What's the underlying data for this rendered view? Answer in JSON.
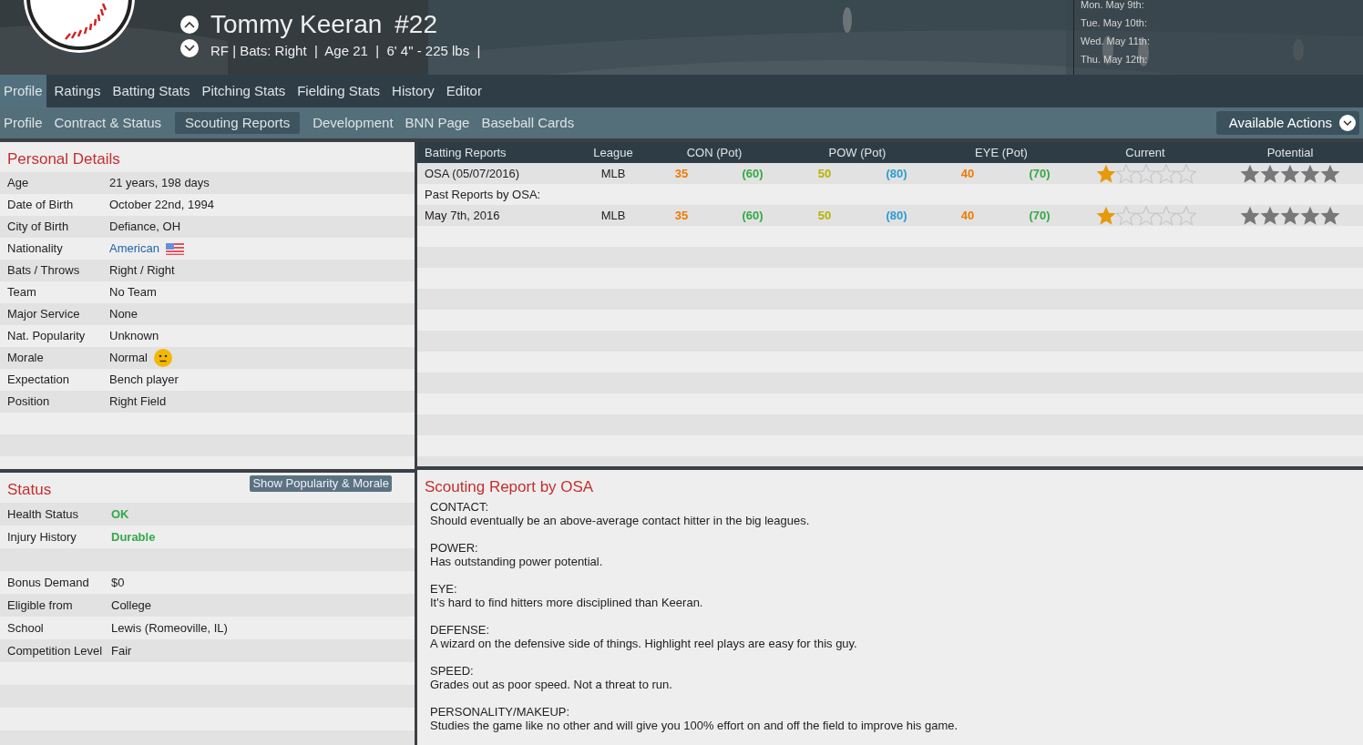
{
  "player": {
    "name": "Tommy Keeran",
    "number": "#22",
    "summary": "RF | Bats: Right  |  Age 21  |  6' 4\" - 225 lbs  |"
  },
  "schedule": [
    "Mon. May 9th:",
    "Tue. May 10th:",
    "Wed. May 11th:",
    "Thu. May 12th:"
  ],
  "main_tabs": [
    {
      "label": "Profile",
      "selected": true
    },
    {
      "label": "Ratings",
      "selected": false
    },
    {
      "label": "Batting Stats",
      "selected": false
    },
    {
      "label": "Pitching Stats",
      "selected": false
    },
    {
      "label": "Fielding Stats",
      "selected": false
    },
    {
      "label": "History",
      "selected": false
    },
    {
      "label": "Editor",
      "selected": false
    }
  ],
  "sub_tabs": [
    {
      "label": "Profile",
      "selected": false
    },
    {
      "label": "Contract & Status",
      "selected": false
    },
    {
      "label": "Scouting Reports",
      "selected": true
    },
    {
      "label": "Development",
      "selected": false
    },
    {
      "label": "BNN Page",
      "selected": false
    },
    {
      "label": "Baseball Cards",
      "selected": false
    }
  ],
  "actions_button": "Available Actions",
  "personal_details": {
    "title": "Personal Details",
    "rows": [
      {
        "label": "Age",
        "value": "21 years, 198 days",
        "kind": "text"
      },
      {
        "label": "Date of Birth",
        "value": "October 22nd, 1994",
        "kind": "text"
      },
      {
        "label": "City of Birth",
        "value": "Defiance, OH",
        "kind": "text"
      },
      {
        "label": "Nationality",
        "value": "American",
        "kind": "link"
      },
      {
        "label": "Bats / Throws",
        "value": "Right / Right",
        "kind": "text"
      },
      {
        "label": "Team",
        "value": "No Team",
        "kind": "text"
      },
      {
        "label": "Major Service",
        "value": "None",
        "kind": "text"
      },
      {
        "label": "Nat. Popularity",
        "value": "Unknown",
        "kind": "text"
      },
      {
        "label": "Morale",
        "value": "Normal",
        "kind": "morale"
      },
      {
        "label": "Expectation",
        "value": "Bench player",
        "kind": "text"
      },
      {
        "label": "Position",
        "value": "Right Field",
        "kind": "text"
      }
    ]
  },
  "status": {
    "title": "Status",
    "button": "Show Popularity & Morale",
    "health": [
      {
        "label": "Health Status",
        "value": "OK",
        "kind": "good"
      },
      {
        "label": "Injury History",
        "value": "Durable",
        "kind": "good"
      }
    ],
    "draft": [
      {
        "label": "Bonus Demand",
        "value": "$0",
        "kind": "text"
      },
      {
        "label": "Eligible from",
        "value": "College",
        "kind": "text"
      },
      {
        "label": "School",
        "value": "Lewis (Romeoville, IL)",
        "kind": "text"
      },
      {
        "label": "Competition Level",
        "value": "Fair",
        "kind": "text"
      }
    ]
  },
  "reports_table": {
    "columns": [
      "Batting Reports",
      "League",
      "CON (Pot)",
      "POW (Pot)",
      "EYE (Pot)",
      "Current",
      "Potential"
    ],
    "rows": [
      {
        "kind": "report",
        "scout": "OSA (05/07/2016)",
        "league": "MLB",
        "ratings": [
          {
            "value": "35",
            "color": "#f07800"
          },
          {
            "value": "(60)",
            "color": "#36a845"
          },
          {
            "value": "50",
            "color": "#b5b300"
          },
          {
            "value": "(80)",
            "color": "#2c9ccf"
          },
          {
            "value": "40",
            "color": "#f07800"
          },
          {
            "value": "(70)",
            "color": "#36a845"
          }
        ],
        "current": {
          "stars": 1
        },
        "potential": {
          "stars": 5
        }
      },
      {
        "kind": "section",
        "label": "Past Reports by OSA:"
      },
      {
        "kind": "report",
        "scout": "May 7th, 2016",
        "league": "MLB",
        "ratings": [
          {
            "value": "35",
            "color": "#f07800"
          },
          {
            "value": "(60)",
            "color": "#36a845"
          },
          {
            "value": "50",
            "color": "#b5b300"
          },
          {
            "value": "(80)",
            "color": "#2c9ccf"
          },
          {
            "value": "40",
            "color": "#f07800"
          },
          {
            "value": "(70)",
            "color": "#36a845"
          }
        ],
        "current": {
          "stars": 1
        },
        "potential": {
          "stars": 5
        }
      }
    ]
  },
  "scouting_report": {
    "title": "Scouting Report by OSA",
    "sections": [
      {
        "heading": "CONTACT:",
        "text": "Should eventually be an above-average contact hitter in the big leagues."
      },
      {
        "heading": "POWER:",
        "text": "Has outstanding power potential."
      },
      {
        "heading": "EYE:",
        "text": "It's hard to find hitters more disciplined than Keeran."
      },
      {
        "heading": "DEFENSE:",
        "text": "A wizard on the defensive side of things. Highlight reel plays are easy for this guy."
      },
      {
        "heading": "SPEED:",
        "text": "Grades out as poor speed. Not a threat to run."
      },
      {
        "heading": "PERSONALITY/MAKEUP:",
        "text": "Studies the game like no other and will give you 100% effort on and off the field to improve his game."
      }
    ]
  }
}
